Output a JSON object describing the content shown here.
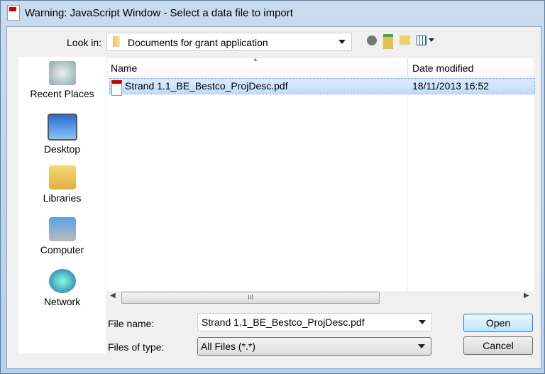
{
  "window": {
    "title": "Warning: JavaScript Window - Select a data file to import"
  },
  "look_in": {
    "label": "Look in:",
    "value": "Documents for grant application"
  },
  "toolbar": {
    "icons": [
      "back-icon",
      "up-folder-icon",
      "new-folder-icon",
      "view-menu-icon"
    ]
  },
  "places": [
    {
      "label": "Recent Places",
      "icon": "recent-places-icon"
    },
    {
      "label": "Desktop",
      "icon": "desktop-icon"
    },
    {
      "label": "Libraries",
      "icon": "libraries-icon"
    },
    {
      "label": "Computer",
      "icon": "computer-icon"
    },
    {
      "label": "Network",
      "icon": "network-icon"
    }
  ],
  "columns": {
    "name": "Name",
    "date": "Date modified"
  },
  "files": [
    {
      "name": "Strand 1.1_BE_Bestco_ProjDesc.pdf",
      "date": "18/11/2013 16:52"
    }
  ],
  "file_name": {
    "label": "File name:",
    "value": "Strand 1.1_BE_Bestco_ProjDesc.pdf"
  },
  "file_type": {
    "label": "Files of type:",
    "value": "All Files (*.*)"
  },
  "buttons": {
    "open": "Open",
    "cancel": "Cancel"
  }
}
